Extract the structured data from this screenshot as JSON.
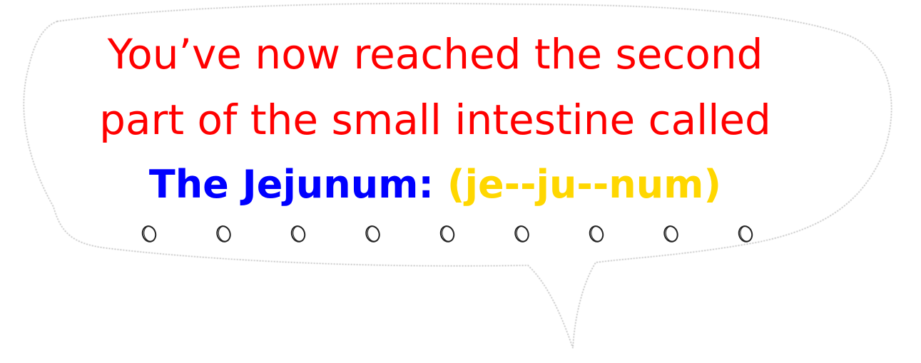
{
  "bubble": {
    "line1": "You’ve now reached the second",
    "line2": "part of the small intestine called",
    "term": "The Jejunum:",
    "pronunciation": "(je--ju--num)",
    "dot_count": 9,
    "dot_icon": "circle-outline-icon"
  },
  "colors": {
    "line_text": "#ff0000",
    "term": "#0000ff",
    "pronunciation": "#ffd700"
  }
}
